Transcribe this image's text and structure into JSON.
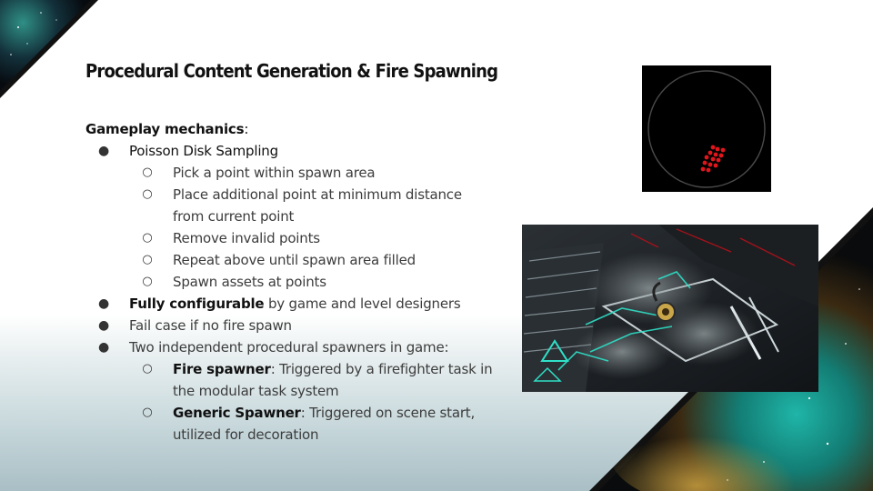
{
  "slide": {
    "title": "Procedural Content Generation & Fire Spawning",
    "heading": "Gameplay mechanics",
    "heading_colon": ":",
    "items": [
      {
        "level": 1,
        "segments": [
          {
            "text": "Poisson Disk Sampling",
            "emph": "dark"
          }
        ]
      },
      {
        "level": 2,
        "segments": [
          {
            "text": "Pick a point within spawn area"
          }
        ]
      },
      {
        "level": 2,
        "segments": [
          {
            "text": "Place additional point at minimum distance"
          }
        ]
      },
      {
        "level": 0,
        "segments": [
          {
            "text": "from current point"
          }
        ]
      },
      {
        "level": 2,
        "segments": [
          {
            "text": "Remove invalid points"
          }
        ]
      },
      {
        "level": 2,
        "segments": [
          {
            "text": "Repeat above until spawn area filled"
          }
        ]
      },
      {
        "level": 2,
        "segments": [
          {
            "text": "Spawn assets at points"
          }
        ]
      },
      {
        "level": 1,
        "segments": [
          {
            "text": "Fully configurable",
            "emph": "strong"
          },
          {
            "text": " by game and level designers"
          }
        ]
      },
      {
        "level": 1,
        "segments": [
          {
            "text": "Fail case if no fire spawn"
          }
        ]
      },
      {
        "level": 1,
        "segments": [
          {
            "text": "Two independent procedural spawners in game:"
          }
        ]
      },
      {
        "level": 2,
        "segments": [
          {
            "text": "Fire spawner",
            "emph": "strong"
          },
          {
            "text": ": Triggered by a firefighter task in"
          }
        ]
      },
      {
        "level": 0,
        "segments": [
          {
            "text": "the modular task system"
          }
        ]
      },
      {
        "level": 2,
        "segments": [
          {
            "text": "Generic Spawner",
            "emph": "strong"
          },
          {
            "text": ": Triggered on scene start,"
          }
        ]
      },
      {
        "level": 0,
        "segments": [
          {
            "text": "utilized for decoration"
          }
        ]
      }
    ]
  },
  "bullets": {
    "level1": "●",
    "level2": "○"
  },
  "colors": {
    "title": "#111111",
    "body": "#3c3c3c",
    "spawn_point": "#e0161c",
    "nebula_teal": "#1aa7a0",
    "panel_black": "#000000"
  },
  "images": {
    "spawn_circle": "poisson-disk-spawn-diagram",
    "game_scene": "game-screenshot"
  }
}
